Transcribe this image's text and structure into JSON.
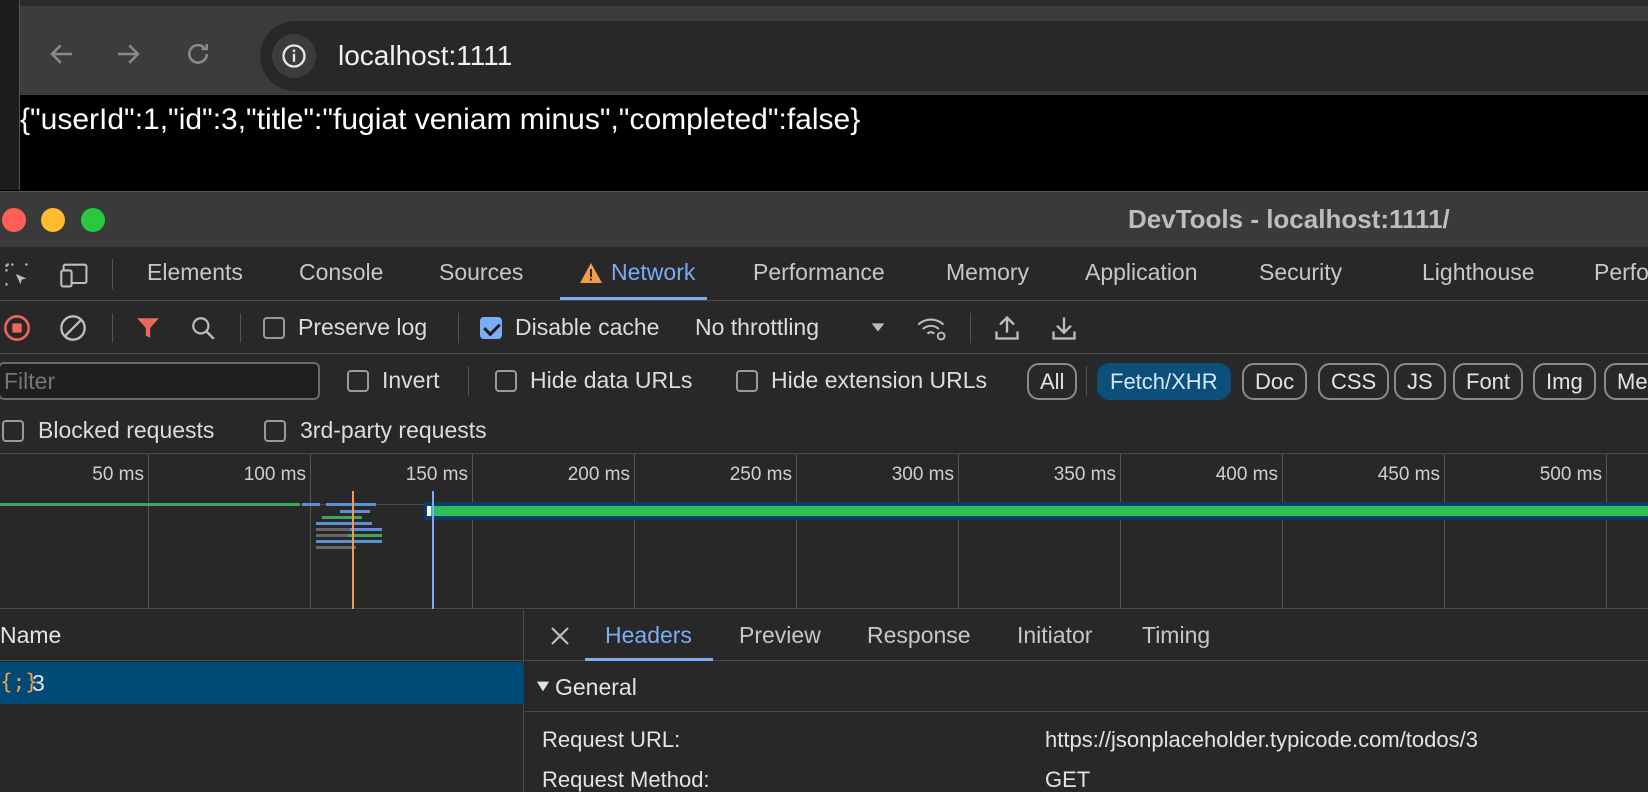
{
  "browser": {
    "url": "localhost:1111",
    "page_text": "{\"userId\":1,\"id\":3,\"title\":\"fugiat veniam minus\",\"completed\":false}"
  },
  "devtools": {
    "window_title": "DevTools - localhost:1111/",
    "tabs": [
      "Elements",
      "Console",
      "Sources",
      "Network",
      "Performance",
      "Memory",
      "Application",
      "Security",
      "Lighthouse",
      "Perfo"
    ],
    "active_tab": "Network",
    "toolbar": {
      "preserve_log": "Preserve log",
      "preserve_log_checked": false,
      "disable_cache": "Disable cache",
      "disable_cache_checked": true,
      "throttling": "No throttling"
    },
    "filter": {
      "placeholder": "Filter",
      "invert": "Invert",
      "hide_data_urls": "Hide data URLs",
      "hide_extension_urls": "Hide extension URLs",
      "type_chips": [
        "All",
        "Fetch/XHR",
        "Doc",
        "CSS",
        "JS",
        "Font",
        "Img",
        "Me"
      ],
      "active_chip": "Fetch/XHR",
      "blocked_requests": "Blocked requests",
      "third_party_requests": "3rd-party requests"
    },
    "timeline": {
      "ticks": [
        "50 ms",
        "100 ms",
        "150 ms",
        "200 ms",
        "250 ms",
        "300 ms",
        "350 ms",
        "400 ms",
        "450 ms",
        "500 ms"
      ]
    },
    "requests": {
      "column_header": "Name",
      "rows": [
        {
          "icon": "{;}",
          "name": "3"
        }
      ]
    },
    "details": {
      "tabs": [
        "Headers",
        "Preview",
        "Response",
        "Initiator",
        "Timing"
      ],
      "active_tab": "Headers",
      "section": "General",
      "fields": [
        {
          "key": "Request URL:",
          "value": "https://jsonplaceholder.typicode.com/todos/3"
        },
        {
          "key": "Request Method:",
          "value": "GET"
        }
      ]
    }
  },
  "colors": {
    "accent": "#7cacf8",
    "warning": "#f29b4b",
    "close": "#ff5f57",
    "minimize": "#febc2e",
    "maximize": "#28c840",
    "chip_active": "#0b4f7a",
    "row_selected": "#004a77"
  }
}
